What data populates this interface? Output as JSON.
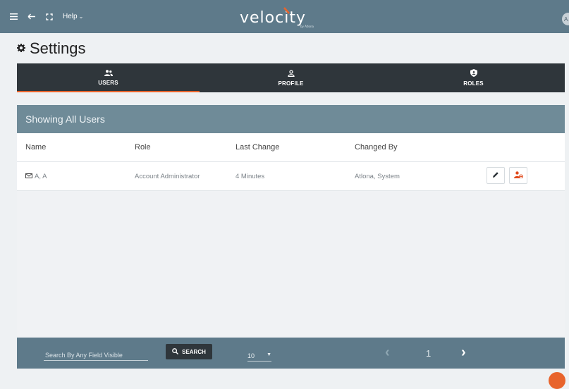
{
  "topbar": {
    "menu_icon": "hamburger-icon",
    "back_icon": "arrow-left-icon",
    "fullscreen_icon": "fullscreen-icon",
    "help_label": "Help",
    "logo_text": "velocity",
    "logo_sub": "by Atlona",
    "avatar_initials": "A A"
  },
  "page": {
    "title": "Settings",
    "title_icon": "gear-icon"
  },
  "tabs": [
    {
      "label": "USERS",
      "icon": "users-icon",
      "active": true
    },
    {
      "label": "PROFILE",
      "icon": "profile-icon",
      "active": false
    },
    {
      "label": "ROLES",
      "icon": "shield-icon",
      "active": false
    }
  ],
  "panel": {
    "header": "Showing All Users",
    "columns": [
      "Name",
      "Role",
      "Last Change",
      "Changed By"
    ],
    "rows": [
      {
        "name": "A, A",
        "role": "Account Administrator",
        "last_change": "4 Minutes",
        "changed_by": "Atlona, System"
      }
    ]
  },
  "footer": {
    "search_placeholder": "Search By Any Field Visible",
    "search_label": "SEARCH",
    "page_size": "10",
    "page_number": "1"
  },
  "colors": {
    "topbar": "#5e7a8a",
    "tabs_bg": "#2f363b",
    "accent": "#e8642c",
    "panel_header": "#6f8b98"
  }
}
